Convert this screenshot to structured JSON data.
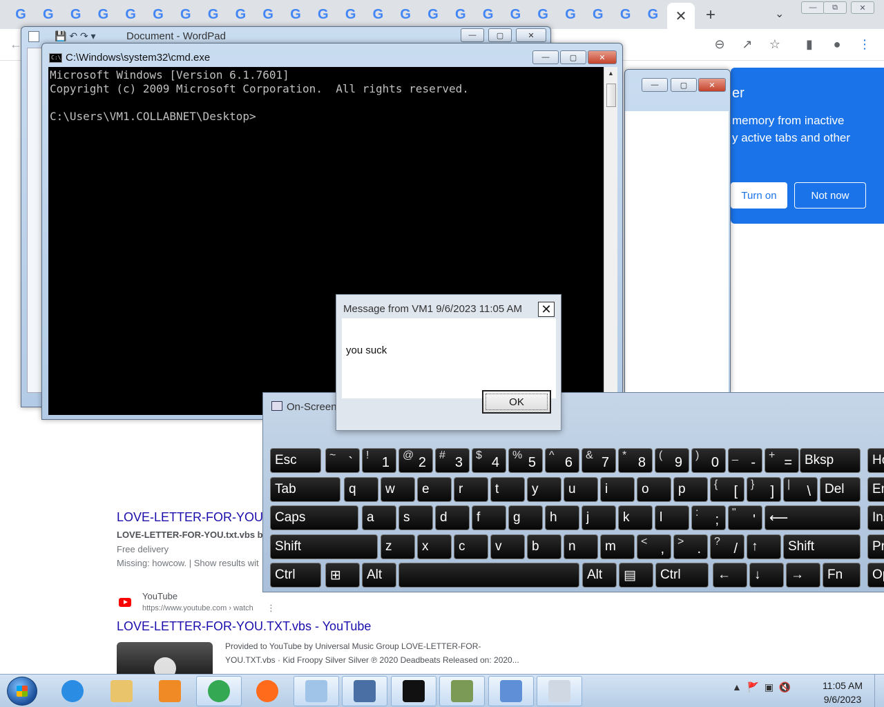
{
  "chrome": {
    "tab_favicon": "G",
    "tab_count": 24,
    "close_glyph": "✕",
    "new_tab_glyph": "+",
    "tab_search_glyph": "⌄"
  },
  "serp": {
    "result1_title": "LOVE-LETTER-FOR-YOU.t",
    "result1_snippet": "LOVE-LETTER-FOR-YOU.txt.vbs by B",
    "result1_delivery": "Free delivery",
    "result1_missing": "Missing: howcow. | Show results wit",
    "result2_site": "YouTube",
    "result2_url": "https://www.youtube.com › watch",
    "result2_title": "LOVE-LETTER-FOR-YOU.TXT.vbs - YouTube",
    "result2_desc1": "Provided to YouTube by Universal Music Group LOVE-LETTER-FOR-",
    "result2_desc2": "YOU.TXT.vbs · Kid Froopy Silver Silver ℗ 2020 Deadbeats Released on: 2020..."
  },
  "memory_popup": {
    "title_fragment": "er",
    "line1": "memory from inactive",
    "line2": "y active tabs and other",
    "turn_on": "Turn on",
    "not_now": "Not now"
  },
  "wordpad": {
    "title": "Document - WordPad"
  },
  "cmd": {
    "title": "C:\\Windows\\system32\\cmd.exe",
    "output": "Microsoft Windows [Version 6.1.7601]\nCopyright (c) 2009 Microsoft Corporation.  All rights reserved.\n\nC:\\Users\\VM1.COLLABNET\\Desktop>"
  },
  "message_box": {
    "title": "Message from VM1 9/6/2023 11:05 AM",
    "text": "you suck",
    "ok": "OK",
    "close": "✕"
  },
  "osk": {
    "title": "On-Screen",
    "rows": [
      [
        {
          "main": "Esc"
        },
        {
          "sm": "~",
          "big": "`"
        },
        {
          "sm": "!",
          "big": "1"
        },
        {
          "sm": "@",
          "big": "2"
        },
        {
          "sm": "#",
          "big": "3"
        },
        {
          "sm": "$",
          "big": "4"
        },
        {
          "sm": "%",
          "big": "5"
        },
        {
          "sm": "^",
          "big": "6"
        },
        {
          "sm": "&",
          "big": "7"
        },
        {
          "sm": "*",
          "big": "8"
        },
        {
          "sm": "(",
          "big": "9"
        },
        {
          "sm": ")",
          "big": "0"
        },
        {
          "sm": "_",
          "big": "-"
        },
        {
          "sm": "+",
          "big": "="
        },
        {
          "main": "Bksp"
        },
        {
          "main": "Ho"
        }
      ],
      [
        {
          "main": "Tab"
        },
        {
          "main": "q"
        },
        {
          "main": "w"
        },
        {
          "main": "e"
        },
        {
          "main": "r"
        },
        {
          "main": "t"
        },
        {
          "main": "y"
        },
        {
          "main": "u"
        },
        {
          "main": "i"
        },
        {
          "main": "o"
        },
        {
          "main": "p"
        },
        {
          "sm": "{",
          "big": "["
        },
        {
          "sm": "}",
          "big": "]"
        },
        {
          "sm": "|",
          "big": "\\"
        },
        {
          "main": "Del"
        },
        {
          "main": "En"
        }
      ],
      [
        {
          "main": "Caps"
        },
        {
          "main": "a"
        },
        {
          "main": "s"
        },
        {
          "main": "d"
        },
        {
          "main": "f"
        },
        {
          "main": "g"
        },
        {
          "main": "h"
        },
        {
          "main": "j"
        },
        {
          "main": "k"
        },
        {
          "main": "l"
        },
        {
          "sm": ":",
          "big": ";"
        },
        {
          "sm": "\"",
          "big": "'"
        },
        {
          "main": "⟵"
        },
        {
          "main": "Ins"
        }
      ],
      [
        {
          "main": "Shift"
        },
        {
          "main": "z"
        },
        {
          "main": "x"
        },
        {
          "main": "c"
        },
        {
          "main": "v"
        },
        {
          "main": "b"
        },
        {
          "main": "n"
        },
        {
          "main": "m"
        },
        {
          "sm": "<",
          "big": ","
        },
        {
          "sm": ">",
          "big": "."
        },
        {
          "sm": "?",
          "big": "/"
        },
        {
          "main": "↑"
        },
        {
          "main": "Shift"
        },
        {
          "main": "Pr"
        }
      ],
      [
        {
          "main": "Ctrl"
        },
        {
          "main": "⊞"
        },
        {
          "main": "Alt"
        },
        {
          "main": ""
        },
        {
          "main": "Alt"
        },
        {
          "main": "▤"
        },
        {
          "main": "Ctrl"
        },
        {
          "main": "←"
        },
        {
          "main": "↓"
        },
        {
          "main": "→"
        },
        {
          "main": "Fn"
        },
        {
          "main": "Op"
        }
      ]
    ]
  },
  "taskbar": {
    "items": [
      "internet-explorer-icon",
      "file-explorer-icon",
      "media-player-icon",
      "chrome-icon",
      "firefox-icon",
      "notepad-icon",
      "network-icon",
      "cmd-icon",
      "osk-icon",
      "wordpad-icon",
      "document-icon"
    ],
    "time": "11:05 AM",
    "date": "9/6/2023"
  }
}
